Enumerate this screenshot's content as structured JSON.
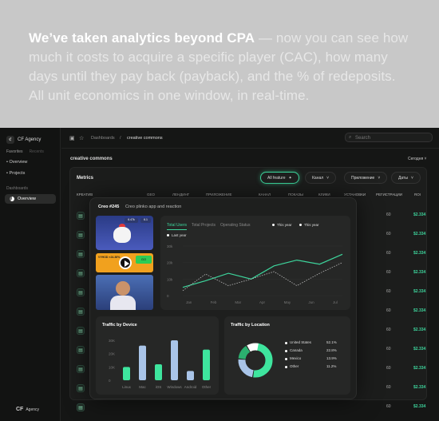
{
  "hero": {
    "lead": "We’ve taken analytics beyond CPA",
    "body": " — now you can see how much it costs to acquire a specific player (CAC), how many days until they pay back (payback), and the % of redeposits. All unit economics in one window, in real-time."
  },
  "sidebar": {
    "brand": "CF Agency",
    "tabs": [
      "Favorites",
      "Recents"
    ],
    "items": [
      "Overview",
      "Projects"
    ],
    "section": "Dashboards",
    "active": "Overview",
    "footer_brand": "CF",
    "footer_sub": "Agency"
  },
  "topbar": {
    "crumb1": "Dashboards",
    "crumb_sep": "/",
    "crumb2": "creative commons",
    "search_placeholder": "Search"
  },
  "workspace": {
    "title": "creative commons",
    "period": "Сегодня"
  },
  "metrics": {
    "title": "Metrics",
    "chips": [
      "All feature",
      "Канал",
      "Приложение",
      "Даты"
    ],
    "headers": [
      "КРЕАТИВ",
      "GEO",
      "ЛЕНДИНГ",
      "ПРИЛОЖЕНИЕ",
      "КАНАЛ",
      "ПОКАЗЫ",
      "КЛИКИ",
      "УСТАНОВКИ",
      "РЕГИСТРАЦИИ",
      "ROI"
    ],
    "rows": [
      {
        "val": "60",
        "money": "$2.334"
      },
      {
        "val": "60",
        "money": "$2.334"
      },
      {
        "val": "60",
        "money": "$2.334"
      },
      {
        "val": "60",
        "money": "$2.334"
      },
      {
        "val": "60",
        "money": "$2.334"
      },
      {
        "val": "60",
        "money": "$2.334"
      },
      {
        "val": "60",
        "money": "$2.334"
      },
      {
        "val": "60",
        "money": "$2.334"
      },
      {
        "val": "60",
        "money": "$2.334"
      },
      {
        "val": "60",
        "money": "$2.334"
      },
      {
        "val": "60",
        "money": "$2.334"
      }
    ]
  },
  "overlay": {
    "title": "Creo #245",
    "subtitle": "Creo plinko app and reaction",
    "creo_stat1": "6.47k",
    "creo_stat2": "6.1",
    "creo_banner": "VYHOD ×24.36%",
    "creo_button": "GO",
    "tabs": [
      "Total Users",
      "Total Projects",
      "Operating Status"
    ],
    "legend": [
      "This year",
      "This year",
      "Last year"
    ],
    "y_ticks": [
      "30k",
      "20k",
      "10k",
      "0"
    ],
    "x_ticks": [
      "Jan",
      "Feb",
      "Mar",
      "Apr",
      "May",
      "Jun",
      "Jul"
    ],
    "device_title": "Traffic by Device",
    "device_ticks": [
      "30K",
      "20K",
      "10K",
      "0"
    ],
    "location_title": "Traffic by Location"
  },
  "chart_data": [
    {
      "type": "line",
      "x": [
        "Jan",
        "Feb",
        "Mar",
        "Apr",
        "May",
        "Jun",
        "Jul"
      ],
      "ylim": [
        0,
        30000
      ],
      "series": [
        {
          "name": "This year",
          "values": [
            5000,
            9000,
            13500,
            10000,
            18000,
            21500,
            19000,
            25000
          ]
        },
        {
          "name": "Last year",
          "values": [
            3000,
            13000,
            6000,
            10000,
            14500,
            6000,
            13500,
            20000
          ]
        }
      ],
      "colors": [
        "#3dd59c",
        "#bbbbbb"
      ]
    },
    {
      "type": "bar",
      "title": "Traffic by Device",
      "categories": [
        "Linux",
        "Mac",
        "iOS",
        "Windows",
        "Android",
        "Other"
      ],
      "values": [
        10000,
        26000,
        12000,
        30000,
        7000,
        23000
      ],
      "ylim": [
        0,
        30000
      ],
      "colors": [
        "#3ee59e",
        "#a9c4e8",
        "#3ee59e",
        "#a9c4e8",
        "#a9c4e8",
        "#3ee59e"
      ]
    },
    {
      "type": "pie",
      "title": "Traffic by Location",
      "labels": [
        "United States",
        "Canada",
        "Mexico",
        "Other"
      ],
      "values": [
        52.1,
        22.8,
        13.9,
        11.2
      ],
      "display": [
        "52.1%",
        "22.8%",
        "13.9%",
        "11.2%"
      ],
      "colors": [
        "#3ee59e",
        "#a9c4e8",
        "#2bb06f",
        "#ffffff"
      ]
    }
  ]
}
